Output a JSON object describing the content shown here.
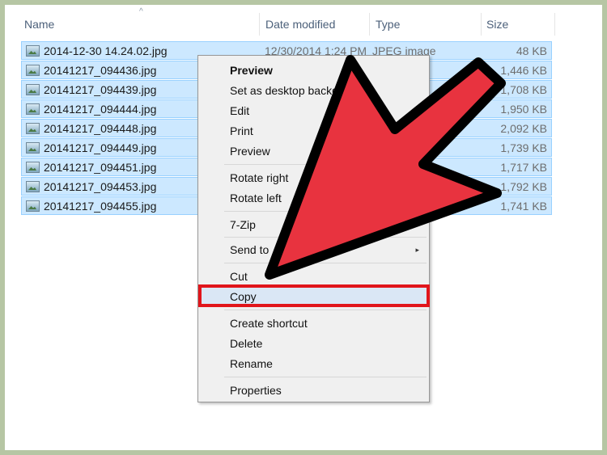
{
  "header": {
    "name": "Name",
    "date_modified": "Date modified",
    "type": "Type",
    "size": "Size",
    "sort_indicator": "^"
  },
  "files": [
    {
      "name": "2014-12-30 14.24.02.jpg",
      "date": "12/30/2014 1:24 PM",
      "type": "JPEG image",
      "size": "48 KB"
    },
    {
      "name": "20141217_094436.jpg",
      "date": "",
      "type": "",
      "size": "1,446 KB"
    },
    {
      "name": "20141217_094439.jpg",
      "date": "",
      "type": "",
      "size": "1,708 KB"
    },
    {
      "name": "20141217_094444.jpg",
      "date": "",
      "type": "",
      "size": "1,950 KB"
    },
    {
      "name": "20141217_094448.jpg",
      "date": "",
      "type": "",
      "size": "2,092 KB"
    },
    {
      "name": "20141217_094449.jpg",
      "date": "",
      "type": "",
      "size": "1,739 KB"
    },
    {
      "name": "20141217_094451.jpg",
      "date": "",
      "type": "",
      "size": "1,717 KB"
    },
    {
      "name": "20141217_094453.jpg",
      "date": "",
      "type": "",
      "size": "1,792 KB"
    },
    {
      "name": "20141217_094455.jpg",
      "date": "",
      "type": "",
      "size": "1,741 KB"
    }
  ],
  "context_menu": {
    "preview_bold": "Preview",
    "set_desktop_background": "Set as desktop backgro",
    "edit": "Edit",
    "print": "Print",
    "preview": "Preview",
    "rotate_right": "Rotate right",
    "rotate_left": "Rotate left",
    "seven_zip": "7-Zip",
    "send_to": "Send to",
    "submenu_arrow": "▸",
    "cut": "Cut",
    "copy": "Copy",
    "create_shortcut": "Create shortcut",
    "delete": "Delete",
    "rename": "Rename",
    "properties": "Properties"
  },
  "annotations": {
    "arrow_color": "#e8333f",
    "arrow_outline": "#000000",
    "highlight_box_color": "#e1151b",
    "frame_color": "#b6c6a4"
  }
}
